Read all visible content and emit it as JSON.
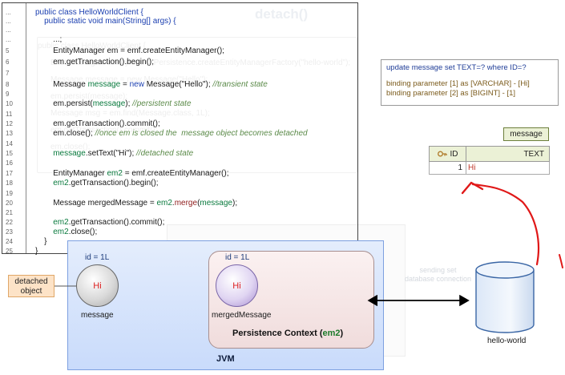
{
  "ghost": {
    "title": "detach()",
    "code_lines": [
      "public class HelloWorldClient {",
      "EntityManagerFactory emf = Persistence.createEntityManagerFactory(\"hello-world\");",
      "Message message = new Message(\"Hello\");",
      "em.persist(message);",
      "Message msg = em.find(Message.class, 1L);",
      "em.getTransaction().commit();",
      "em.close();"
    ],
    "pc_label": "Persistence Context (em",
    "jvm_label": "JVM",
    "connection_text": "sending set\ndatabase connection",
    "db_label": "hello-world"
  },
  "code": [
    {
      "ln": "...",
      "parts": [
        {
          "t": "public class HelloWorldClient {",
          "c": "kw"
        }
      ]
    },
    {
      "ln": "...",
      "parts": [
        {
          "t": "    public static void main(String[] args) {",
          "c": "kw"
        }
      ]
    },
    {
      "ln": "...",
      "parts": []
    },
    {
      "ln": "...",
      "parts": [
        {
          "t": "        ...;",
          "c": ""
        }
      ]
    },
    {
      "ln": "5",
      "parts": [
        {
          "t": "        EntityManager em = emf.createEntityManager();",
          "c": ""
        }
      ]
    },
    {
      "ln": "6",
      "parts": [
        {
          "t": "        em.getTransaction().begin();",
          "c": ""
        }
      ]
    },
    {
      "ln": "7",
      "parts": []
    },
    {
      "ln": "8",
      "parts": [
        {
          "t": "        Message ",
          "c": ""
        },
        {
          "t": "message",
          "c": "var"
        },
        {
          "t": " = ",
          "c": ""
        },
        {
          "t": "new",
          "c": "kw"
        },
        {
          "t": " Message(\"Hello\"); ",
          "c": ""
        },
        {
          "t": "//transient state",
          "c": "cm"
        }
      ]
    },
    {
      "ln": "9",
      "parts": []
    },
    {
      "ln": "10",
      "parts": [
        {
          "t": "        em.persist(",
          "c": ""
        },
        {
          "t": "message",
          "c": "var"
        },
        {
          "t": "); ",
          "c": ""
        },
        {
          "t": "//persistent state",
          "c": "cm"
        }
      ]
    },
    {
      "ln": "11",
      "parts": []
    },
    {
      "ln": "12",
      "parts": [
        {
          "t": "        em.getTransaction().commit();",
          "c": ""
        }
      ]
    },
    {
      "ln": "13",
      "parts": [
        {
          "t": "        em.close(); ",
          "c": ""
        },
        {
          "t": "//once em is closed the  message object becomes detached",
          "c": "cm"
        }
      ]
    },
    {
      "ln": "14",
      "parts": []
    },
    {
      "ln": "15",
      "parts": [
        {
          "t": "        message",
          "c": "var"
        },
        {
          "t": ".setText(\"Hi\"); ",
          "c": ""
        },
        {
          "t": "//detached state",
          "c": "cm"
        }
      ]
    },
    {
      "ln": "16",
      "parts": []
    },
    {
      "ln": "17",
      "parts": [
        {
          "t": "        EntityManager ",
          "c": ""
        },
        {
          "t": "em2",
          "c": "var"
        },
        {
          "t": " = emf.createEntityManager();",
          "c": ""
        }
      ]
    },
    {
      "ln": "18",
      "parts": [
        {
          "t": "        em2",
          "c": "var"
        },
        {
          "t": ".getTransaction().begin();",
          "c": ""
        }
      ]
    },
    {
      "ln": "19",
      "parts": []
    },
    {
      "ln": "20",
      "parts": [
        {
          "t": "        Message mergedMessage = ",
          "c": ""
        },
        {
          "t": "em2",
          "c": "var"
        },
        {
          "t": ".",
          "c": ""
        },
        {
          "t": "merge",
          "c": "method"
        },
        {
          "t": "(",
          "c": ""
        },
        {
          "t": "message",
          "c": "var"
        },
        {
          "t": ");",
          "c": ""
        }
      ]
    },
    {
      "ln": "21",
      "parts": []
    },
    {
      "ln": "22",
      "parts": [
        {
          "t": "        em2",
          "c": "var"
        },
        {
          "t": ".getTransaction().commit();",
          "c": ""
        }
      ]
    },
    {
      "ln": "23",
      "parts": [
        {
          "t": "        em2",
          "c": "var"
        },
        {
          "t": ".close();",
          "c": ""
        }
      ]
    },
    {
      "ln": "24",
      "parts": [
        {
          "t": "    }",
          "c": ""
        }
      ]
    },
    {
      "ln": "25",
      "parts": [
        {
          "t": "}",
          "c": ""
        }
      ]
    }
  ],
  "sql": {
    "query_prefix": "update ",
    "query_table": "message",
    "query_rest": " set TEXT=? where ID=?",
    "binding1": "binding parameter [1] as [VARCHAR] - [Hi]",
    "binding2": "binding parameter [2] as [BIGINT] - [1]"
  },
  "table": {
    "name": "message",
    "col_id": "ID",
    "col_text": "TEXT",
    "row_id": "1",
    "row_text": "Hi"
  },
  "jvm": {
    "label": "JVM",
    "detached_label": "detached object",
    "message_obj": {
      "id": "id = 1L",
      "value": "Hi",
      "label": "message"
    },
    "merged_obj": {
      "id": "id = 1L",
      "value": "Hi",
      "label": "mergedMessage"
    },
    "pc_title": "Persistence  Context (",
    "pc_em": "em2",
    "pc_close": ")"
  },
  "db": {
    "label": "hello-world"
  },
  "colors": {
    "annotation": "#e01818",
    "jvm": "#c9dbfb",
    "pc": "#f0dcdc",
    "detached": "#fde3c7"
  }
}
